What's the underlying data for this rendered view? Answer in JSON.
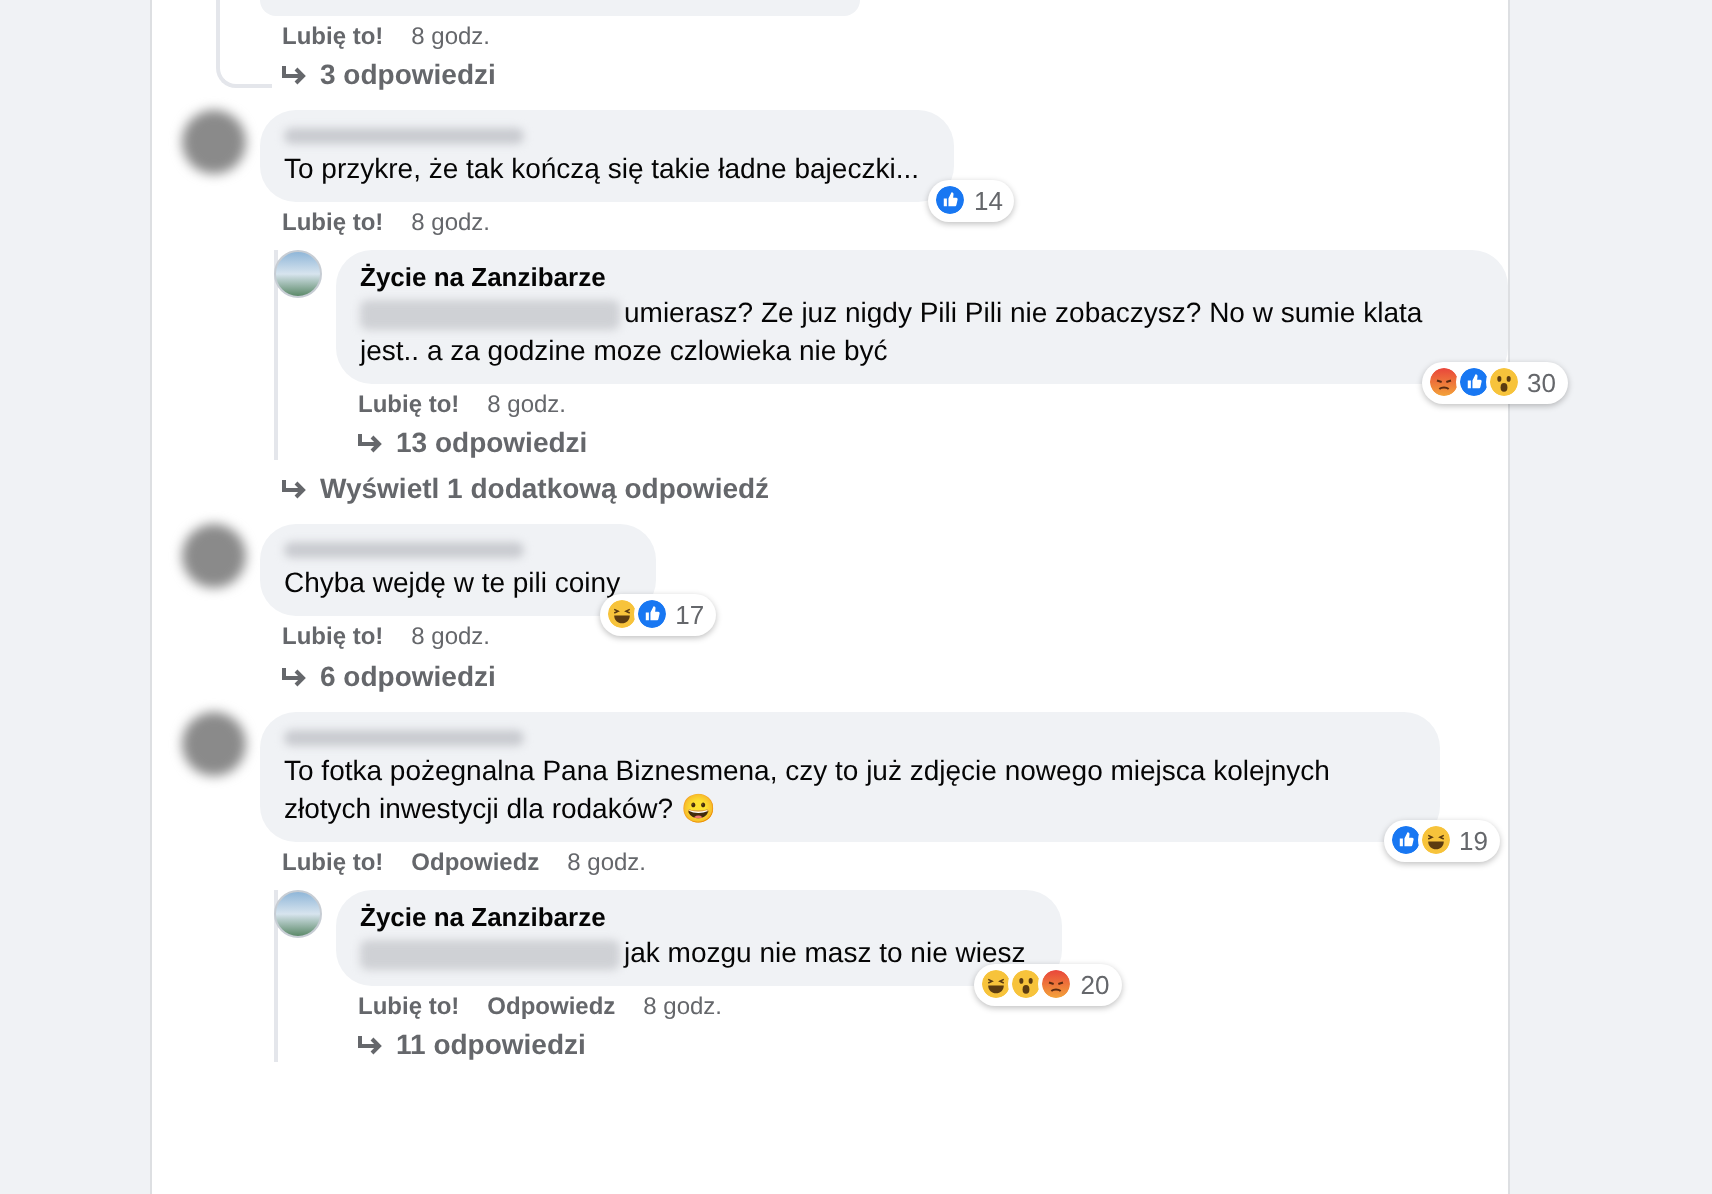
{
  "top_fragment": {
    "actions": [
      {
        "label": "Lubię to!"
      }
    ],
    "time": "8 godz.",
    "replies_link": "3 odpowiedzi"
  },
  "comments": [
    {
      "author_hidden": true,
      "text": "To przykre, że tak kończą się takie ładne bajeczki...",
      "reactions": [
        {
          "kind": "like"
        }
      ],
      "reaction_count": "14",
      "actions": [
        {
          "label": "Lubię to!"
        }
      ],
      "time": "8 godz.",
      "replies": [
        {
          "author": "Życie na Zanzibarze",
          "prefix_hidden": true,
          "text": "umierasz? Ze juz nigdy Pili Pili nie zobaczysz? No w sumie klata jest.. a za godzine moze czlowieka nie być",
          "reactions": [
            {
              "kind": "angry"
            },
            {
              "kind": "like"
            },
            {
              "kind": "wow"
            }
          ],
          "reaction_count": "30",
          "actions": [
            {
              "label": "Lubię to!"
            }
          ],
          "time": "8 godz.",
          "replies_link": "13 odpowiedzi"
        }
      ],
      "more_link": "Wyświetl 1 dodatkową odpowiedź"
    },
    {
      "author_hidden": true,
      "text": "Chyba wejdę w te pili coiny",
      "reactions": [
        {
          "kind": "haha"
        },
        {
          "kind": "like"
        }
      ],
      "reaction_count": "17",
      "actions": [
        {
          "label": "Lubię to!"
        }
      ],
      "time": "8 godz.",
      "replies_link": "6 odpowiedzi"
    },
    {
      "author_hidden": true,
      "text": "To fotka pożegnalna Pana Biznesmena, czy to już zdjęcie nowego miejsca kolejnych złotych inwestycji dla rodaków? 😀",
      "reactions": [
        {
          "kind": "like"
        },
        {
          "kind": "haha"
        }
      ],
      "reaction_count": "19",
      "actions": [
        {
          "label": "Lubię to!"
        },
        {
          "label": "Odpowiedz"
        }
      ],
      "time": "8 godz.",
      "replies": [
        {
          "author": "Życie na Zanzibarze",
          "prefix_hidden": true,
          "text": "jak mozgu nie masz to nie wiesz",
          "reactions": [
            {
              "kind": "haha"
            },
            {
              "kind": "wow"
            },
            {
              "kind": "angry"
            }
          ],
          "reaction_count": "20",
          "actions": [
            {
              "label": "Lubię to!"
            },
            {
              "label": "Odpowiedz"
            }
          ],
          "time": "8 godz.",
          "replies_link": "11 odpowiedzi"
        }
      ]
    }
  ]
}
